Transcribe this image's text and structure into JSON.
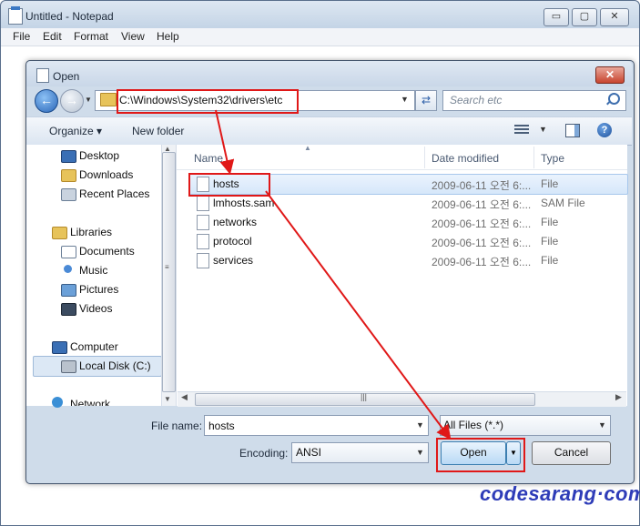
{
  "notepad": {
    "title": "Untitled - Notepad",
    "menu": [
      "File",
      "Edit",
      "Format",
      "View",
      "Help"
    ],
    "caption_buttons": {
      "min": "▭",
      "max": "▢",
      "close": "✕"
    }
  },
  "dialog": {
    "title": "Open",
    "close_glyph": "✕",
    "address_path": "C:\\Windows\\System32\\drivers\\etc",
    "search_placeholder": "Search etc",
    "toolbar": {
      "organize": "Organize ▾",
      "new_folder": "New folder",
      "help": "?"
    },
    "nav": {
      "items": [
        {
          "label": "Desktop",
          "icon": "desktop-icon"
        },
        {
          "label": "Downloads",
          "icon": "downloads-folder-icon"
        },
        {
          "label": "Recent Places",
          "icon": "recent-places-icon"
        },
        {
          "label": "Libraries",
          "icon": "libraries-icon"
        },
        {
          "label": "Documents",
          "icon": "documents-icon"
        },
        {
          "label": "Music",
          "icon": "music-icon"
        },
        {
          "label": "Pictures",
          "icon": "pictures-icon"
        },
        {
          "label": "Videos",
          "icon": "videos-icon"
        },
        {
          "label": "Computer",
          "icon": "computer-icon"
        },
        {
          "label": "Local Disk (C:)",
          "icon": "local-disk-icon",
          "selected": true
        },
        {
          "label": "Network",
          "icon": "network-icon"
        }
      ]
    },
    "columns": {
      "name": "Name",
      "date": "Date modified",
      "type": "Type"
    },
    "files": [
      {
        "name": "hosts",
        "date": "2009-06-11 오전 6:...",
        "type": "File",
        "selected": true
      },
      {
        "name": "lmhosts.sam",
        "date": "2009-06-11 오전 6:...",
        "type": "SAM File"
      },
      {
        "name": "networks",
        "date": "2009-06-11 오전 6:...",
        "type": "File"
      },
      {
        "name": "protocol",
        "date": "2009-06-11 오전 6:...",
        "type": "File"
      },
      {
        "name": "services",
        "date": "2009-06-11 오전 6:...",
        "type": "File"
      }
    ],
    "file_name_label": "File name:",
    "file_name_value": "hosts",
    "file_type_filter": "All Files  (*.*)",
    "encoding_label": "Encoding:",
    "encoding_value": "ANSI",
    "open_label": "Open",
    "cancel_label": "Cancel"
  },
  "watermark": "codesarang·com",
  "colors": {
    "annotation_red": "#e01818",
    "watermark_blue": "#2e3cb8",
    "selection": "#d6e7fa"
  }
}
